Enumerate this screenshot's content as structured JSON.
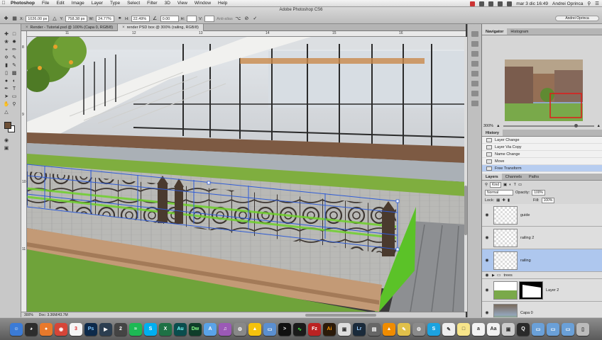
{
  "menubar": {
    "apple_icon": "apple-icon",
    "items": [
      "Photoshop",
      "File",
      "Edit",
      "Image",
      "Layer",
      "Type",
      "Select",
      "Filter",
      "3D",
      "View",
      "Window",
      "Help"
    ],
    "clock": "mar 3 dic 16:49",
    "user": "Andrei Oprinca"
  },
  "optionsbar": {
    "app_title": "Adobe Photoshop CS6",
    "x_value": "1026.00 px",
    "y_value": "758.38 px",
    "w_label": "W:",
    "w_value": "24.77%",
    "h_label": "H:",
    "h_value": "22.49%",
    "angle_value": "0.00",
    "antialias_label": "Anti-alias",
    "workspace": "Andrei Oprinca"
  },
  "tabs": [
    {
      "label": "Render - Tutorial.psd @ 100% (Capa 0, RGB/8)",
      "active": false
    },
    {
      "label": "render PSD box @ 300% (railing, RGB/8)",
      "active": true
    }
  ],
  "ruler": {
    "h_numbers": [
      "11",
      "12",
      "13",
      "14",
      "15",
      "16"
    ],
    "v_numbers": [
      "8",
      "9",
      "10",
      "11"
    ]
  },
  "statusbar": {
    "zoom": "300%",
    "doc": "Doc: 3.36M/43.7M"
  },
  "navigator": {
    "tabs": [
      "Navigator",
      "Histogram"
    ],
    "zoom": "300%"
  },
  "history": {
    "tab": "History",
    "items": [
      {
        "label": "Layer Change",
        "selected": false
      },
      {
        "label": "Layer Via Copy",
        "selected": false
      },
      {
        "label": "Name Change",
        "selected": false
      },
      {
        "label": "Move",
        "selected": false
      },
      {
        "label": "Free Transform",
        "selected": true
      }
    ]
  },
  "layers": {
    "tabs": [
      "Layers",
      "Channels",
      "Paths"
    ],
    "kind_label": "Kind",
    "blend_mode": "Normal",
    "opacity_label": "Opacity:",
    "opacity_value": "100%",
    "lock_label": "Lock:",
    "fill_label": "Fill:",
    "fill_value": "100%",
    "items": [
      {
        "name": "guide",
        "type": "pixel",
        "selected": false
      },
      {
        "name": "railing 2",
        "type": "pixel",
        "selected": false
      },
      {
        "name": "railing",
        "type": "pixel",
        "selected": true
      },
      {
        "name": "trees",
        "type": "group",
        "selected": false
      },
      {
        "name": "Layer 2",
        "type": "masked",
        "selected": false
      },
      {
        "name": "Capa 0",
        "type": "image",
        "selected": false
      }
    ]
  },
  "dock": {
    "apps": [
      "finder-icon",
      "dashboard-icon",
      "firefox-icon",
      "chrome-icon",
      "calendar-icon",
      "photoshop-icon",
      "video-icon",
      "app-icon",
      "spotify-icon",
      "skype-icon",
      "excel-icon",
      "audition-icon",
      "dreamweaver-icon",
      "store-icon",
      "itunes-icon",
      "utility-icon",
      "google-drive-icon",
      "folder-icon",
      "terminal-icon",
      "activity-icon",
      "filezilla-icon",
      "illustrator-icon",
      "preview-icon",
      "lightroom-icon",
      "monitor-icon",
      "vlc-icon",
      "notes-icon",
      "settings-icon",
      "skype-s-icon",
      "textedit-icon",
      "stickies-icon",
      "font-icon",
      "dictionary-icon",
      "preview2-icon",
      "quicktime-icon",
      "folder2-icon",
      "folder3-icon",
      "folder4-icon",
      "trash-icon"
    ],
    "labels": {
      "calendar": "3",
      "photoshop": "Ps",
      "audition": "Au",
      "dreamweaver": "Dw",
      "illustrator": "Ai",
      "lightroom": "Lr"
    }
  },
  "colors": {
    "selection": "#aec7ee",
    "accent_blue": "#2f5cd6",
    "grass": "#6fa33a"
  }
}
